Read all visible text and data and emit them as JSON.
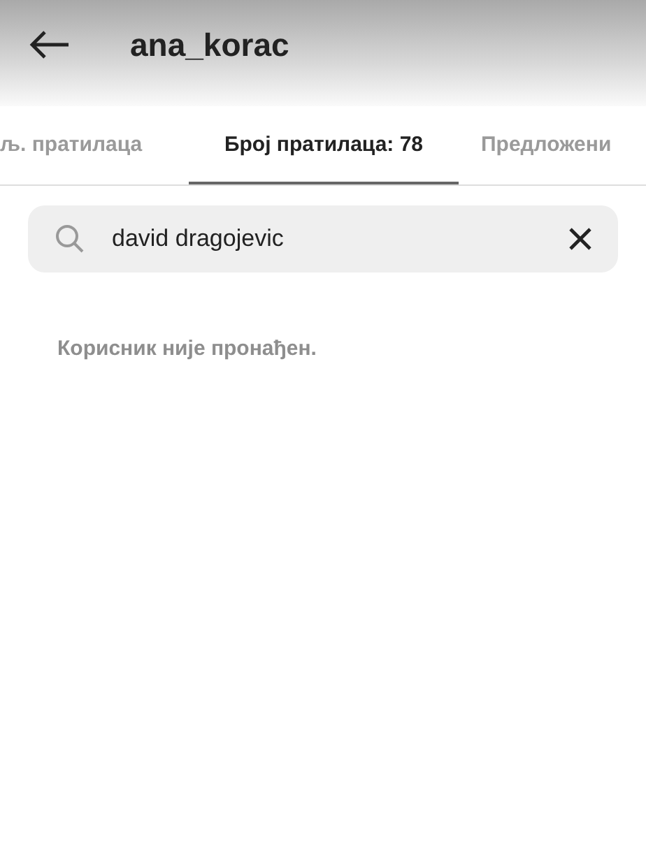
{
  "header": {
    "title": "ana_korac"
  },
  "tabs": [
    {
      "label": "љ. пратилаца",
      "selected": false
    },
    {
      "label": "Број пратилаца: 78",
      "selected": true
    },
    {
      "label": "Предложени",
      "selected": false
    }
  ],
  "search": {
    "value": "david dragojevic"
  },
  "message": "Корисник није пронађен."
}
